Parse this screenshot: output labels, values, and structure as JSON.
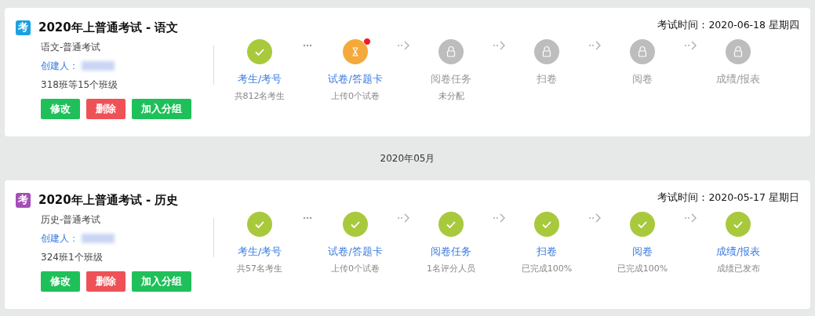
{
  "exams": [
    {
      "badge": "考",
      "color": "#1ba1e2",
      "title": "2020年上普通考试 - 语文",
      "subject": "语文-普通考试",
      "creator_label": "创建人：",
      "classes": "318班等15个班级",
      "buttons": [
        {
          "label": "修改",
          "kind": "edit"
        },
        {
          "label": "删除",
          "kind": "delete"
        },
        {
          "label": "加入分组",
          "kind": "group"
        }
      ],
      "exam_time": "考试时间：2020-06-18 星期四",
      "connectors": [
        {
          "kind": "dots"
        },
        {
          "kind": "arrow"
        },
        {
          "kind": "arrow"
        },
        {
          "kind": "arrow"
        },
        {
          "kind": "arrow"
        }
      ],
      "steps": [
        {
          "label": "考生/考号",
          "detail": "共812名考生",
          "kind": "done",
          "alert": false
        },
        {
          "label": "试卷/答题卡",
          "detail": "上传0个试卷",
          "kind": "pending",
          "alert": true
        },
        {
          "label": "阅卷任务",
          "detail": "未分配",
          "kind": "locked",
          "alert": false
        },
        {
          "label": "扫卷",
          "kind": "locked",
          "alert": false
        },
        {
          "label": "阅卷",
          "kind": "locked",
          "alert": false
        },
        {
          "label": "成绩/报表",
          "kind": "locked",
          "alert": false
        }
      ]
    },
    {
      "group_label": "2020年05月",
      "badge": "考",
      "color": "#a44fb6",
      "title": "2020年上普通考试 - 历史",
      "subject": "历史-普通考试",
      "creator_label": "创建人：",
      "classes": "324班1个班级",
      "buttons": [
        {
          "label": "修改",
          "kind": "edit"
        },
        {
          "label": "删除",
          "kind": "delete"
        },
        {
          "label": "加入分组",
          "kind": "group"
        }
      ],
      "exam_time": "考试时间：2020-05-17 星期日",
      "connectors": [
        {
          "kind": "dots"
        },
        {
          "kind": "arrow"
        },
        {
          "kind": "arrow"
        },
        {
          "kind": "arrow"
        },
        {
          "kind": "arrow"
        }
      ],
      "steps": [
        {
          "label": "考生/考号",
          "detail": "共57名考生",
          "kind": "done",
          "alert": false
        },
        {
          "label": "试卷/答题卡",
          "detail": "上传0个试卷",
          "kind": "done",
          "alert": false
        },
        {
          "label": "阅卷任务",
          "detail": "1名评分人员",
          "kind": "done",
          "alert": false
        },
        {
          "label": "扫卷",
          "detail": "已完成100%",
          "kind": "done",
          "alert": false
        },
        {
          "label": "阅卷",
          "detail": "已完成100%",
          "kind": "done",
          "alert": false
        },
        {
          "label": "成绩/报表",
          "detail": "成绩已发布",
          "kind": "done",
          "alert": false
        }
      ]
    }
  ]
}
